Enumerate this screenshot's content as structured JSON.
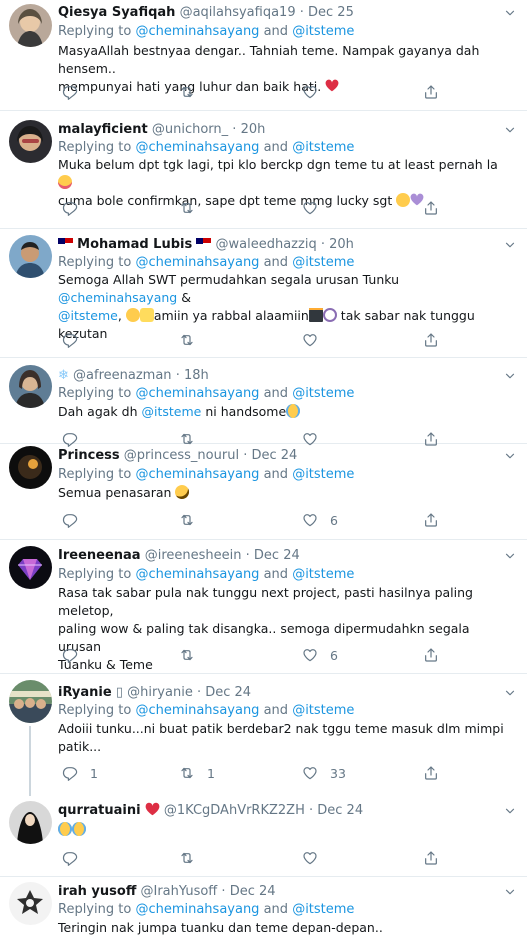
{
  "tweets": [
    {
      "name": "Qiesya Syafiqah",
      "handle": "@aqilahsyafiqa19",
      "time": "Dec 25",
      "replying": "Replying to",
      "to1": "@cheminahsayang",
      "and": "and",
      "to2": "@itsteme",
      "line1": "MasyaAllah bestnyaa dengar.. Tahniah teme. Nampak gayanya dah hensem..",
      "line2": "mempunyai hati yang luhur dan baik hati.",
      "emoji": [
        "red-heart"
      ],
      "counts": {
        "reply": "",
        "retweet": "",
        "like": ""
      }
    },
    {
      "name": "malayficient",
      "handle": "@unichorn_",
      "time": "20h",
      "replying": "Replying to",
      "to1": "@cheminahsayang",
      "and": "and",
      "to2": "@itsteme",
      "line1": "Muka belum dpt tgk lagi, tpi klo berckp dgn teme tu at least pernah la",
      "line2": "cuma bole confirmkan, sape dpt teme mmg lucky sgt",
      "emoji": [
        "tongue-face",
        "weary-face",
        "purple-heart"
      ],
      "counts": {
        "reply": "",
        "retweet": "",
        "like": ""
      }
    },
    {
      "name": "Mohamad Lubis",
      "handle": "@waleedhazziq",
      "time": "20h",
      "replying": "Replying to",
      "to1": "@cheminahsayang",
      "and": "and",
      "to2": "@itsteme",
      "line1a": "Semoga Allah SWT permudahkan segala urusan Tunku",
      "line1b": "&",
      "line2a": ",",
      "line2b": "amiin ya rabbal alaamiin",
      "line2c": "tak sabar nak tunggu",
      "line3": "kezutan",
      "emoji": [
        "flag-malaysia",
        "smiling-face",
        "raising-hands",
        "kaaba",
        "prayer-beads"
      ],
      "counts": {
        "reply": "",
        "retweet": "",
        "like": ""
      }
    },
    {
      "name": "",
      "handle": "@afreenazman",
      "time": "18h",
      "replying": "Replying to",
      "to1": "@cheminahsayang",
      "and": "and",
      "to2": "@itsteme",
      "line1a": "Dah agak dh",
      "line1b": "ni handsome",
      "emoji": [
        "snowflake",
        "loudly-crying-face"
      ],
      "counts": {
        "reply": "",
        "retweet": "",
        "like": ""
      }
    },
    {
      "name": "Princess",
      "handle": "@princess_nourul",
      "time": "Dec 24",
      "replying": "Replying to",
      "to1": "@cheminahsayang",
      "and": "and",
      "to2": "@itsteme",
      "line1": "Semua penasaran",
      "emoji": [
        "rolling-laughing-face"
      ],
      "counts": {
        "reply": "",
        "retweet": "",
        "like": "6"
      }
    },
    {
      "name": "Ireeneenaa",
      "handle": "@ireenesheein",
      "time": "Dec 24",
      "replying": "Replying to",
      "to1": "@cheminahsayang",
      "and": "and",
      "to2": "@itsteme",
      "line1": "Rasa tak sabar pula nak tunggu next project, pasti hasilnya paling meletop,",
      "line2": "paling wow & paling tak disangka.. semoga dipermudahkn segala urusan",
      "line3": "Tuanku & Teme",
      "counts": {
        "reply": "",
        "retweet": "",
        "like": "6"
      }
    },
    {
      "name": "iRyanie",
      "badge": "▯",
      "handle": "@hiryanie",
      "time": "Dec 24",
      "replying": "Replying to",
      "to1": "@cheminahsayang",
      "and": "and",
      "to2": "@itsteme",
      "line1": "Adoiii tunku...ni buat patik berdebar2 nak tggu teme masuk dlm mimpi",
      "line2": "patik...",
      "counts": {
        "reply": "1",
        "retweet": "1",
        "like": "33"
      }
    },
    {
      "name": "qurratuaini",
      "handle": "@1KCgDAhVrRKZ2ZH",
      "time": "Dec 24",
      "emoji": [
        "red-heart",
        "tears-of-joy-face",
        "tears-of-joy-face"
      ],
      "counts": {
        "reply": "",
        "retweet": "",
        "like": ""
      }
    },
    {
      "name": "irah yusoff",
      "handle": "@IrahYusoff",
      "time": "Dec 24",
      "replying": "Replying to",
      "to1": "@cheminahsayang",
      "and": "and",
      "to2": "@itsteme",
      "line1": "Teringin nak jumpa tuanku dan teme depan-depan.."
    }
  ],
  "colors": {
    "link": "#1b95e0",
    "secondary": "#657786",
    "text": "#14171a",
    "divider": "#e6ecf0",
    "heart": "#e0245e"
  }
}
